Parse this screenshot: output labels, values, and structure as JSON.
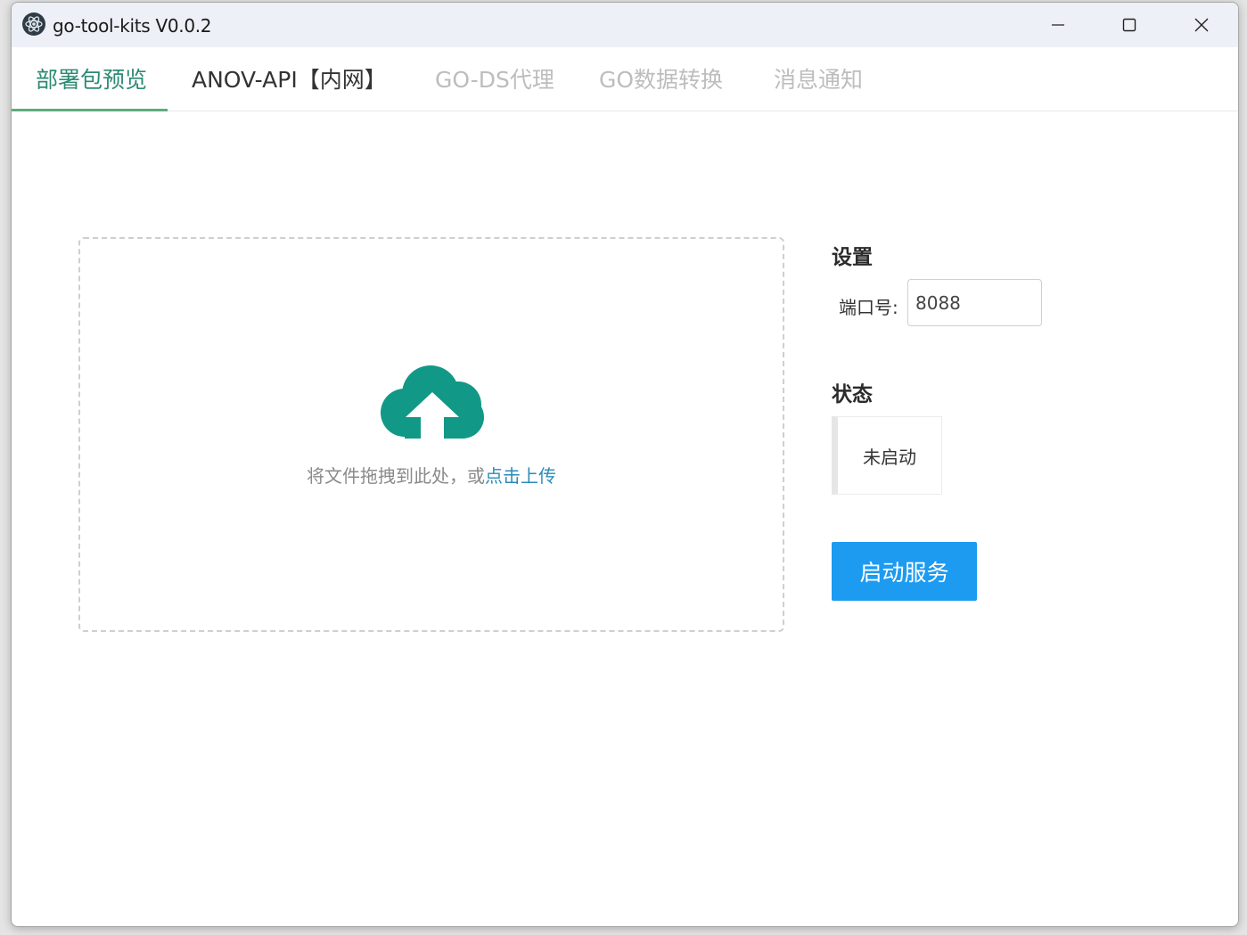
{
  "window": {
    "title": "go-tool-kits V0.0.2",
    "icon": "atom-icon",
    "controls": [
      "minimize-icon",
      "maximize-icon",
      "close-icon"
    ]
  },
  "tabs": [
    {
      "label": "部署包预览",
      "state": "active"
    },
    {
      "label": "ANOV-API【内网】",
      "state": "enabled"
    },
    {
      "label": "GO-DS代理",
      "state": "disabled"
    },
    {
      "label": "GO数据转换",
      "state": "disabled"
    },
    {
      "label": "消息通知",
      "state": "disabled"
    }
  ],
  "upload": {
    "icon": "cloud-upload-icon",
    "hint": "将文件拖拽到此处，或",
    "link": "点击上传"
  },
  "settings": {
    "heading": "设置",
    "port_label": "端口号:",
    "port_value": "8088"
  },
  "status": {
    "heading": "状态",
    "value": "未启动"
  },
  "actions": {
    "start_label": "启动服务"
  },
  "colors": {
    "active_tab": "#2d8a74",
    "tab_underline": "#5eac7f",
    "cloud_icon": "#129886",
    "link": "#2a8bb8",
    "primary_button": "#1c9bf1",
    "disabled_tab": "#bdbdbd"
  }
}
